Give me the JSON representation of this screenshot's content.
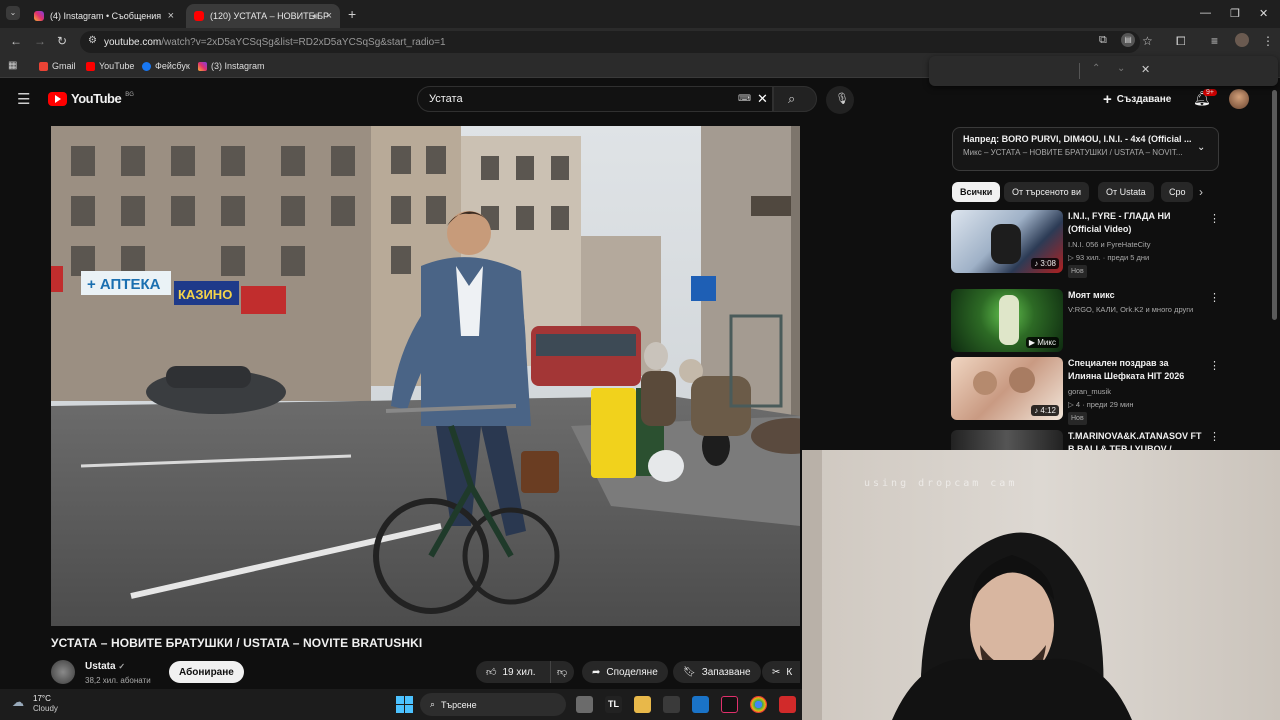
{
  "browser": {
    "tabs": [
      {
        "label": "(4) Instagram • Съобщения",
        "active": false
      },
      {
        "label": "(120) УСТАТА – НОВИТЕ БР",
        "active": true
      }
    ],
    "url_host": "youtube.com",
    "url_rest": "/watch?v=2xD5aYCSqSg&list=RD2xD5aYCSqSg&start_radio=1",
    "bookmarks": [
      "Gmail",
      "YouTube",
      "Фейсбук",
      "(3) Instagram"
    ]
  },
  "youtube": {
    "logo_text": "YouTube",
    "region": "BG",
    "search_value": "Устата",
    "create_label": "Създаване",
    "notif_badge": "9+",
    "video_title": "УСТАТА – НОВИТЕ БРАТУШКИ / USTATA – NOVITE BRATUSHKI",
    "channel": {
      "name": "Ustata",
      "subs": "38,2 хил. абонати",
      "subscribe_label": "Абониране"
    },
    "actions": {
      "likes": "19 хил.",
      "share": "Споделяне",
      "save": "Запазване",
      "clip": "К"
    },
    "nextup": {
      "line1": "Напред: BORO PURVI, DIM4OU, I.N.I. - 4x4 (Official ...",
      "line2": "Микс – УСТАТА – НОВИТЕ БРАТУШКИ / USTATA – NOVIT..."
    },
    "chips": [
      "Всички",
      "От търсеното ви",
      "От Ustata",
      "Сро"
    ],
    "recs": [
      {
        "title": "I.N.I., FYRE - ГЛАДА НИ (Official Video)",
        "meta1": "I.N.I. 056 и FyreHateCity",
        "meta2": "93 хил. · преди 5 дни",
        "badge": "Нов",
        "duration": "3:08",
        "colors": [
          "#c8d2dc",
          "#3a4c66",
          "#b22"
        ]
      },
      {
        "title": "Моят микс",
        "meta1": "V:RGO, КАЛИ, Ork.K2 и много други",
        "meta2": "",
        "badge": "",
        "duration": "Микс",
        "colors": [
          "#2f6a2a",
          "#0f2a10",
          "#59b04a"
        ]
      },
      {
        "title": "Специален поздрав за Илияна Шефката HIT 2026",
        "meta1": "goran_musik",
        "meta2": "4 · преди 29 мин",
        "badge": "Нов",
        "duration": "4:12",
        "colors": [
          "#e9c6b0",
          "#b98a74",
          "#f3e0d0"
        ]
      },
      {
        "title": "T.MARINOVA&K.ATANASOV FT B.BALI & TEB LYUBOV /...",
        "meta1": "",
        "meta2": "",
        "badge": "",
        "duration": "",
        "colors": [
          "#333",
          "#555",
          "#222"
        ]
      }
    ]
  },
  "webcam": {
    "overlay_text": "using dropcam cam"
  },
  "taskbar": {
    "weather_temp": "17°C",
    "weather_desc": "Cloudy",
    "search_placeholder": "Търсене"
  }
}
